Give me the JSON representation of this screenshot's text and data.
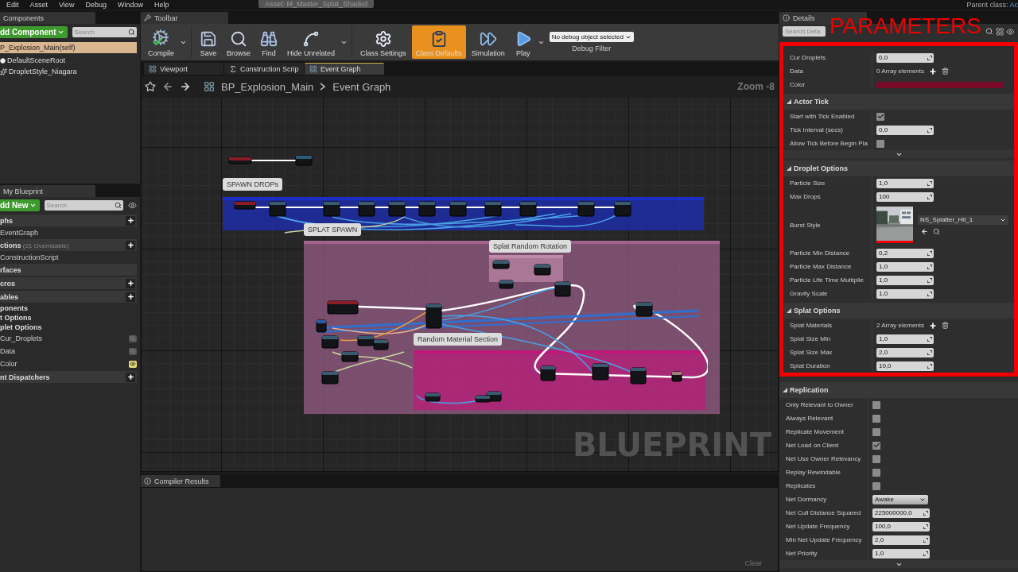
{
  "menu_bar": {
    "items": [
      "Edit",
      "Asset",
      "View",
      "Debug",
      "Window",
      "Help"
    ],
    "asset_tab": "Asset: M_Master_Splat_Shaded",
    "parent_class": "Parent class:",
    "parent_class_value": "Ac"
  },
  "components": {
    "title": "Components",
    "add_button": "dd Component",
    "search": {
      "placeholder": "Search"
    },
    "root": "P_Explosion_Main(self)",
    "items": [
      {
        "kind": "scene",
        "label": "DefaultSceneRoot"
      },
      {
        "kind": "particles",
        "label": "DropletStyle_Niagara"
      }
    ]
  },
  "my_blueprint": {
    "title": "My Blueprint",
    "add_button": "dd New",
    "search": {
      "placeholder": "Search"
    },
    "rows": [
      {
        "kind": "header",
        "label": "phs",
        "addable": true
      },
      {
        "kind": "item",
        "label": "EventGraph"
      },
      {
        "kind": "header",
        "label": "ctions",
        "note": "(21 Overridable)",
        "addable": true
      },
      {
        "kind": "item",
        "label": "ConstructionScript"
      },
      {
        "kind": "header",
        "label": "rfaces",
        "addable": false
      },
      {
        "kind": "header",
        "label": "cros",
        "addable": true
      },
      {
        "kind": "header",
        "label": "ables",
        "addable": true
      },
      {
        "kind": "category",
        "label": "ponents"
      },
      {
        "kind": "category",
        "label": "t Options"
      },
      {
        "kind": "category",
        "label": "plet Options"
      },
      {
        "kind": "variable",
        "label": "Cur_Droplets",
        "exposed": false
      },
      {
        "kind": "variable",
        "label": "Data",
        "exposed": false
      },
      {
        "kind": "variable",
        "label": "Color",
        "exposed": true
      },
      {
        "kind": "header",
        "label": "nt Dispatchers",
        "addable": true
      }
    ]
  },
  "toolbar": {
    "title": "Toolbar",
    "buttons": [
      {
        "kind": "compile",
        "label": "Compile",
        "selected": false,
        "menu": true
      },
      {
        "kind": "save",
        "label": "Save",
        "selected": false,
        "menu": false
      },
      {
        "kind": "browse",
        "label": "Browse",
        "selected": false,
        "menu": false
      },
      {
        "kind": "find",
        "label": "Find",
        "selected": false,
        "menu": false
      },
      {
        "kind": "hide",
        "label": "Hide Unrelated",
        "selected": false,
        "menu": true
      },
      {
        "kind": "settings",
        "label": "Class Settings",
        "selected": false,
        "menu": false
      },
      {
        "kind": "defaults",
        "label": "Class Defaults",
        "selected": true,
        "menu": false
      },
      {
        "kind": "simulation",
        "label": "Simulation",
        "selected": false,
        "menu": false
      },
      {
        "kind": "play",
        "label": "Play",
        "selected": false,
        "menu": true
      }
    ],
    "debug_filter": {
      "value": "No debug object selected",
      "label": "Debug Filter"
    }
  },
  "editor_tabs": [
    {
      "kind": "viewport",
      "label": "Viewport",
      "selected": false
    },
    {
      "kind": "function",
      "label": "Construction Scrip",
      "selected": false
    },
    {
      "kind": "graph",
      "label": "Event Graph",
      "selected": true
    }
  ],
  "graph": {
    "breadcrumb": [
      "BP_Explosion_Main",
      "Event Graph"
    ],
    "zoom": "Zoom -8",
    "graph_type_label": "BLUEPRINT",
    "comments": [
      {
        "label": "SPAWN DROPs",
        "color": "#1c2fc4"
      },
      {
        "label": "SPLAT SPAWN",
        "color": "#a0628e"
      },
      {
        "label": "Splat Random Rotation",
        "color": "#c08aa8"
      },
      {
        "label": "Random Material Section",
        "color": "#c0187a"
      }
    ]
  },
  "compiler_results": {
    "title": "Compiler Results",
    "clear_button": "Clear"
  },
  "details": {
    "title": "Details",
    "search": {
      "placeholder": "Search Deta"
    },
    "annotation": "PARAMETERS",
    "sections": [
      {
        "highlighted": true,
        "advanced": false,
        "rows": [
          {
            "kind": "number",
            "label": "Cur Droplets",
            "value": "0,0"
          },
          {
            "kind": "array",
            "label": "Data",
            "value": "0 Array elements"
          },
          {
            "kind": "color",
            "label": "Color",
            "color": "#7a0a28"
          }
        ]
      },
      {
        "title": "Actor Tick",
        "highlighted": true,
        "advanced": true,
        "rows": [
          {
            "kind": "check",
            "label": "Start with Tick Enabled",
            "checked": true
          },
          {
            "kind": "number",
            "label": "Tick Interval (secs)",
            "value": "0,0"
          },
          {
            "kind": "check",
            "label": "Allow Tick Before Begin Pla",
            "checked": false
          }
        ]
      },
      {
        "title": "Droplet Options",
        "highlighted": true,
        "advanced": false,
        "rows": [
          {
            "kind": "number",
            "label": "Particle Size",
            "value": "1,0"
          },
          {
            "kind": "number",
            "label": "Max Drops",
            "value": "100"
          },
          {
            "kind": "asset",
            "label": "Burst Style",
            "value": "NS_Splatter_Hit_1"
          },
          {
            "kind": "number",
            "label": "Particle Min Distance",
            "value": "0,2"
          },
          {
            "kind": "number",
            "label": "Particle Max Distance",
            "value": "1,0"
          },
          {
            "kind": "number",
            "label": "Particle Life Time Multiplie",
            "value": "1,0"
          },
          {
            "kind": "number",
            "label": "Gravity Scale",
            "value": "1,0"
          }
        ]
      },
      {
        "title": "Splat Options",
        "highlighted": true,
        "advanced": false,
        "rows": [
          {
            "kind": "array",
            "label": "Splat Materials",
            "value": "2 Array elements"
          },
          {
            "kind": "number",
            "label": "Splat Size Min",
            "value": "1,0"
          },
          {
            "kind": "number",
            "label": "Splat Size Max",
            "value": "2,0"
          },
          {
            "kind": "number",
            "label": "Splat Duration",
            "value": "10,0"
          }
        ]
      },
      {
        "title": "Replication",
        "highlighted": false,
        "advanced": true,
        "rows": [
          {
            "kind": "check",
            "label": "Only Relevant to Owner",
            "checked": false
          },
          {
            "kind": "check",
            "label": "Always Relevant",
            "checked": false
          },
          {
            "kind": "check",
            "label": "Replicate Movement",
            "checked": false
          },
          {
            "kind": "check",
            "label": "Net Load on Client",
            "checked": true
          },
          {
            "kind": "check",
            "label": "Net Use Owner Relevancy",
            "checked": false
          },
          {
            "kind": "check",
            "label": "Replay Rewindable",
            "checked": false
          },
          {
            "kind": "check",
            "label": "Replicates",
            "checked": false
          },
          {
            "kind": "dropdown",
            "label": "Net Dormancy",
            "value": "Awake"
          },
          {
            "kind": "number",
            "label": "Net Cull Distance Squared",
            "value": "225000000,0"
          },
          {
            "kind": "number",
            "label": "Net Update Frequency",
            "value": "100,0"
          },
          {
            "kind": "number",
            "label": "Min Net Update Frequency",
            "value": "2,0"
          },
          {
            "kind": "number",
            "label": "Net Priority",
            "value": "1,0"
          }
        ]
      }
    ]
  }
}
